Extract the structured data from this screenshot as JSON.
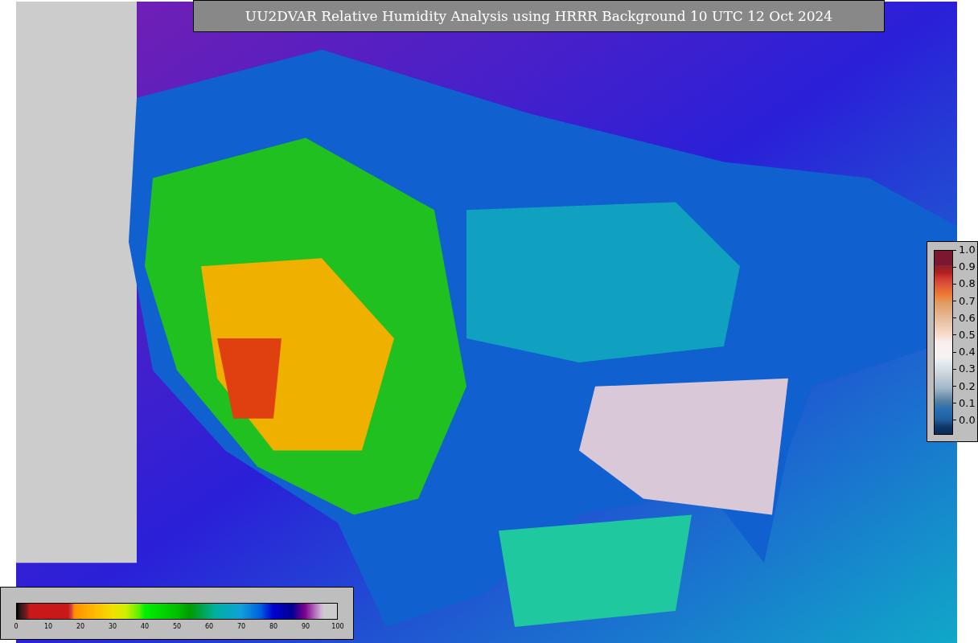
{
  "title": "UU2DVAR Relative Humidity Analysis using HRRR Background 10 UTC 12 Oct 2024",
  "humidity_colorbar": {
    "ticks": [
      "0",
      "10",
      "20",
      "30",
      "40",
      "50",
      "60",
      "70",
      "80",
      "90",
      "100"
    ]
  },
  "side_colorbar": {
    "ticks": [
      "1.0",
      "0.9",
      "0.8",
      "0.7",
      "0.6",
      "0.5",
      "0.4",
      "0.3",
      "0.2",
      "0.1",
      "0.0"
    ]
  }
}
